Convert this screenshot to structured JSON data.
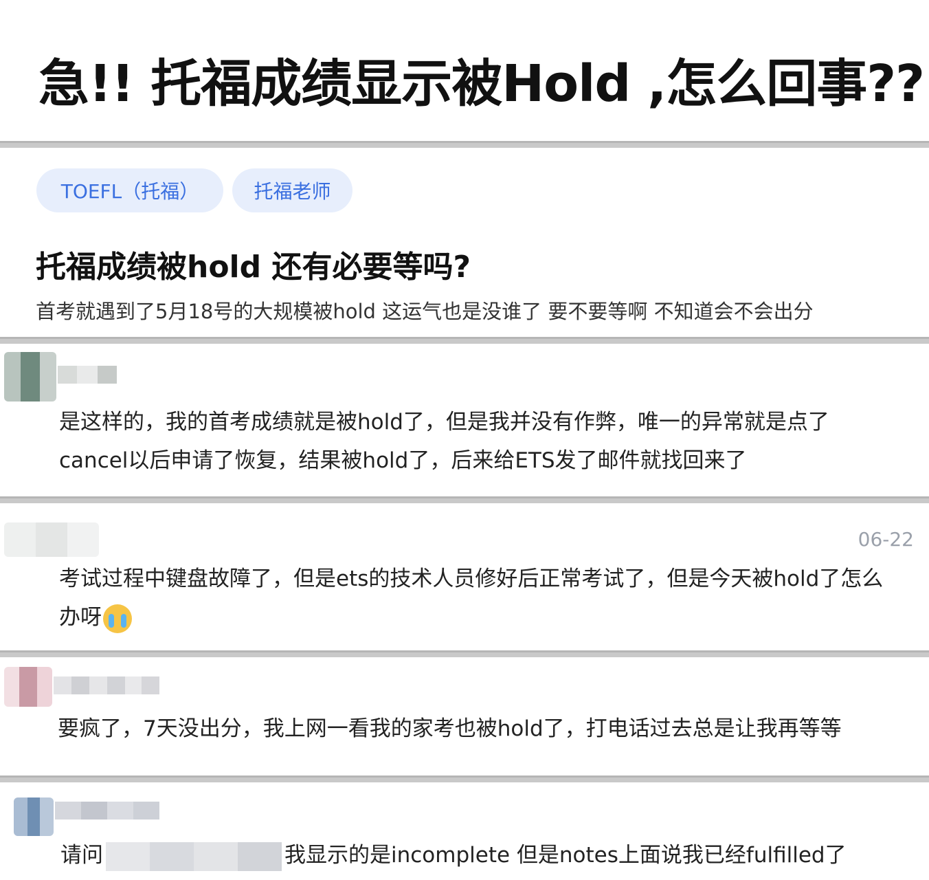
{
  "headline": "急!! 托福成绩显示被Hold ,怎么回事??",
  "tags": [
    "TOEFL（托福）",
    "托福老师"
  ],
  "question": {
    "title": "托福成绩被hold 还有必要等吗?",
    "body": "首考就遇到了5月18号的大规模被hold 这运气也是没谁了 要不要等啊 不知道会不会出分"
  },
  "replies": [
    {
      "line1": "是这样的，我的首考成绩就是被hold了，但是我并没有作弊，唯一的异常就是点了",
      "line2": "cancel以后申请了恢复，结果被hold了，后来给ETS发了邮件就找回来了"
    },
    {
      "date": "06-22",
      "line1": "考试过程中键盘故障了，但是ets的技术人员修好后正常考试了，但是今天被hold了怎么",
      "line2": "办呀",
      "emoji": "crying-face-icon"
    },
    {
      "line1": "要疯了，7天没出分，我上网一看我的家考也被hold了，打电话过去总是让我再等等"
    },
    {
      "prefix": "请问",
      "suffix": "我显示的是incomplete 但是notes上面说我已经fulfilled了"
    }
  ]
}
